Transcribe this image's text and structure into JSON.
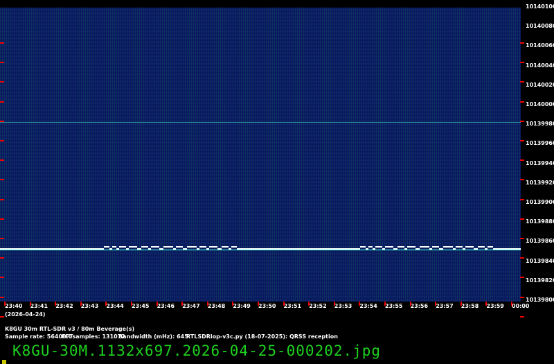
{
  "frequency_labels": [
    "10140100",
    "10140080",
    "10140060",
    "10140040",
    "10140020",
    "10140000",
    "10139980",
    "10139960",
    "10139940",
    "10139920",
    "10139900",
    "10139880",
    "10139860",
    "10139840",
    "10139820",
    "10139800"
  ],
  "time_labels": [
    "23:40",
    "23:41",
    "23:42",
    "23:43",
    "23:44",
    "23:45",
    "23:46",
    "23:47",
    "23:48",
    "23:49",
    "23:50",
    "23:51",
    "23:52",
    "23:53",
    "23:54",
    "23:55",
    "23:56",
    "23:57",
    "23:58",
    "23:59",
    "00:00"
  ],
  "date_label": "(2026-04-24)",
  "station_line": "K8GU 30m RTL-SDR v3 / 80m Beverage(s)",
  "sample_rate": "Sample rate: 56400.0",
  "fft_samples": "FFTsamples: 131072",
  "bandwidth": "Bandwidth (mHz): 645",
  "software": "RTLSDRlop-v3c.py (18-07-2025): QRSS reception",
  "filename": "K8GU-30M.1132x697.2026-04-25-000202.jpg",
  "signal_frequency_hz": 10139850,
  "colors": {
    "background": "#0d1f6a",
    "signal": "#ffffff",
    "ticks": "#ee0000",
    "filename": "#1fd21f"
  }
}
